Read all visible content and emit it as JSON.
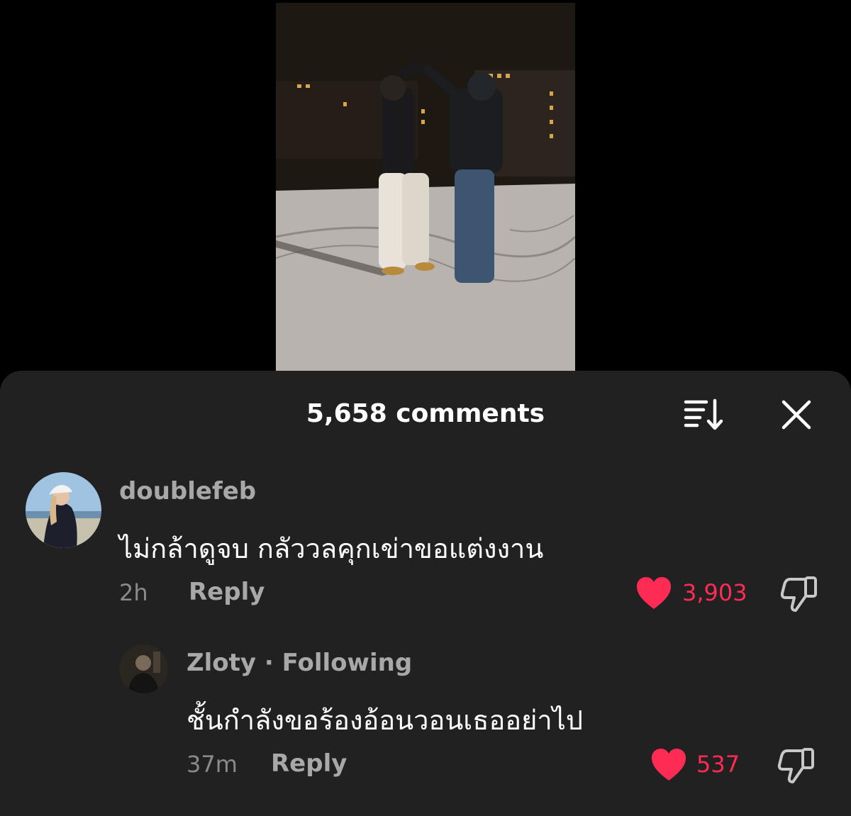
{
  "video": {
    "alt": "video-preview"
  },
  "comments_panel": {
    "title": "5,658 comments",
    "icons": {
      "sort": "sort-icon",
      "close": "close-icon"
    },
    "colors": {
      "background": "#212121",
      "like": "#fe2c55",
      "muted": "#a8a8a8",
      "text": "#ffffff"
    }
  },
  "comments": [
    {
      "username": "doublefeb",
      "text": "ไม่กล้าดูจบ กลัววลคุกเข่าขอแต่งงาน",
      "time": "2h",
      "reply_label": "Reply",
      "likes": "3,903"
    },
    {
      "username": "Zloty · Following",
      "text": "ชั้นกำลังขอร้องอ้อนวอนเธออย่าไป",
      "time": "37m",
      "reply_label": "Reply",
      "likes": "537"
    }
  ]
}
